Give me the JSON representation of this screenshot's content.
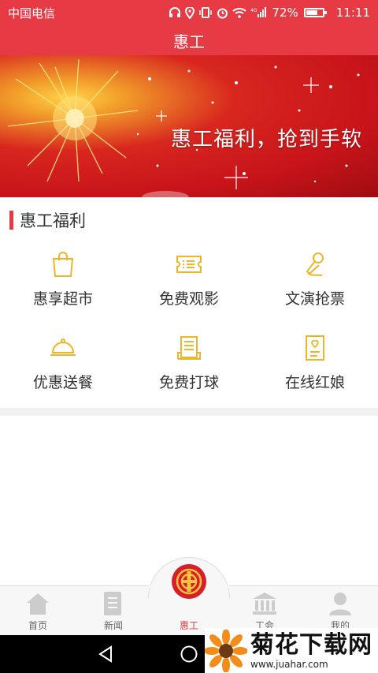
{
  "status_bar": {
    "carrier": "中国电信",
    "network": "4G",
    "battery_percent": "72%",
    "battery_level": 0.72,
    "time": "11:11"
  },
  "app": {
    "title": "惠工",
    "accent_color": "#e63a44"
  },
  "banner": {
    "slogan": "惠工福利，抢到手软"
  },
  "section": {
    "title": "惠工福利"
  },
  "grid": {
    "items": [
      {
        "label": "惠享超市",
        "icon": "shopping-bag-icon"
      },
      {
        "label": "免费观影",
        "icon": "movie-ticket-icon"
      },
      {
        "label": "文演抢票",
        "icon": "microphone-icon"
      },
      {
        "label": "优惠送餐",
        "icon": "food-cloche-icon"
      },
      {
        "label": "免费打球",
        "icon": "sports-court-icon"
      },
      {
        "label": "在线红娘",
        "icon": "love-letter-icon"
      }
    ],
    "icon_color": "#f0b429"
  },
  "tabs": [
    {
      "label": "首页",
      "icon": "home-icon"
    },
    {
      "label": "新闻",
      "icon": "news-icon"
    },
    {
      "label": "惠工",
      "icon": "union-logo-icon",
      "active": true
    },
    {
      "label": "工会",
      "icon": "building-icon"
    },
    {
      "label": "我的",
      "icon": "user-icon"
    }
  ],
  "nav": {
    "back": "back-icon",
    "home": "home-circle-icon"
  },
  "watermark": {
    "title": "菊花下载网",
    "url": "www.juahar.com"
  }
}
